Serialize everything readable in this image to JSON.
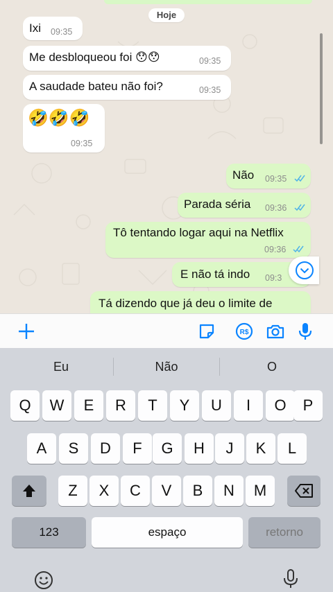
{
  "chat": {
    "date_label": "Hoje",
    "messages": [
      {
        "dir": "in",
        "text": "Ixi",
        "time": "09:35"
      },
      {
        "dir": "in",
        "text": "Me desbloqueou foi 😯😯",
        "time": "09:35"
      },
      {
        "dir": "in",
        "text": "A saudade bateu não foi?",
        "time": "09:35"
      },
      {
        "dir": "in",
        "text": "🤣🤣🤣",
        "time": "09:35"
      },
      {
        "dir": "out",
        "text": "Não",
        "time": "09:35",
        "status": "read"
      },
      {
        "dir": "out",
        "text": "Parada séria",
        "time": "09:36",
        "status": "read"
      },
      {
        "dir": "out",
        "text": "Tô tentando logar aqui na Netflix",
        "time": "09:36",
        "status": "read"
      },
      {
        "dir": "out",
        "text": "E não tá indo",
        "time": "09:3"
      },
      {
        "dir": "out",
        "text": "Tá dizendo que já deu o limite de",
        "time": ""
      }
    ]
  },
  "input_bar": {
    "icons": [
      "plus-icon",
      "sticker-icon",
      "payment-icon",
      "camera-icon",
      "microphone-icon"
    ],
    "payment_symbol": "R$"
  },
  "keyboard": {
    "suggestions": [
      "Eu",
      "Não",
      "O"
    ],
    "row1": [
      "Q",
      "W",
      "E",
      "R",
      "T",
      "Y",
      "U",
      "I",
      "O",
      "P"
    ],
    "row2": [
      "A",
      "S",
      "D",
      "F",
      "G",
      "H",
      "J",
      "K",
      "L"
    ],
    "row3": [
      "Z",
      "X",
      "C",
      "V",
      "B",
      "N",
      "M"
    ],
    "numbers_key": "123",
    "space_key": "espaço",
    "return_key": "retorno"
  },
  "colors": {
    "outgoing_bubble": "#dcf8c6",
    "incoming_bubble": "#ffffff",
    "accent_blue": "#0a84ff",
    "read_ticks": "#4fb3e8"
  }
}
